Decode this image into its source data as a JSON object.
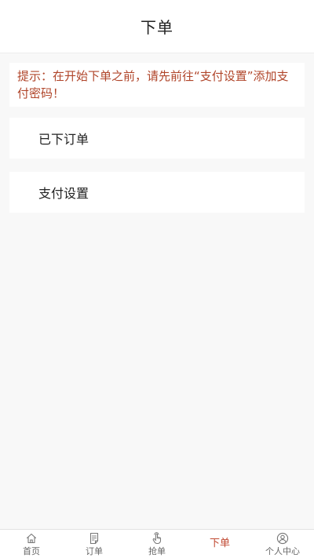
{
  "header": {
    "title": "下单"
  },
  "notice": {
    "text": "提示：在开始下单之前，请先前往“支付设置”添加支付密码！"
  },
  "menu": {
    "items": [
      {
        "label": "已下订单"
      },
      {
        "label": "支付设置"
      }
    ]
  },
  "tabbar": {
    "active": "下单",
    "tabs": [
      {
        "label": "首页",
        "icon": "home-icon"
      },
      {
        "label": "订单",
        "icon": "document-icon"
      },
      {
        "label": "抢单",
        "icon": "hand-pointer-icon"
      },
      {
        "label": "下单",
        "icon": ""
      },
      {
        "label": "个人中心",
        "icon": "user-circle-icon"
      }
    ],
    "colors": {
      "active": "#c14a33",
      "inactive": "#666666"
    }
  },
  "colors": {
    "notice_text": "#b0452a",
    "background": "#f8f8f8"
  }
}
